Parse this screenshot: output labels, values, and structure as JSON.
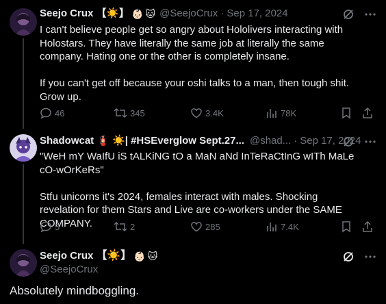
{
  "tweet1": {
    "name": "Seejo Crux",
    "badges": "【☀️】",
    "emoji1": "👶🏻",
    "emoji2": "🐱",
    "handle": "@SeejoCrux",
    "separator": "·",
    "date": "Sep 17, 2024",
    "text": "I can't believe people get so angry about Hololivers interacting with Holostars. They have literally the same job at literally the same company. Hating one or the other is completely insane.\n\nIf you can't get off because your oshi talks to a man, then tough shit. Grow up.",
    "replies": "46",
    "reposts": "345",
    "likes": "3.4K",
    "views": "78K"
  },
  "tweet2": {
    "name": "Shadowcat",
    "badges": "🧯 ☀️| #HSEverglow Sept.27...",
    "handle": "@shad...",
    "separator": "·",
    "date": "Sep 17, 2024",
    "text": "\"WeH mY WaIfU iS tALKiNG tO a MaN aNd InTeRaCtInG wITh MaLe cO-wOrKeRs\"\n\nStfu unicorns it's 2024, females interact with males. Shocking revelation for them Stars and Live are co-workers under the SAME COMPANY.",
    "replies": "5",
    "reposts": "2",
    "likes": "285",
    "views": "7.4K"
  },
  "tweet3": {
    "name": "Seejo Crux",
    "badges": "【☀️】",
    "emoji1": "👶🏻",
    "emoji2": "🐱",
    "handle": "@SeejoCrux",
    "text": "Absolutely mindboggling."
  },
  "colors": {
    "background": "#000000",
    "text": "#e7e9ea",
    "muted": "#71767b"
  }
}
